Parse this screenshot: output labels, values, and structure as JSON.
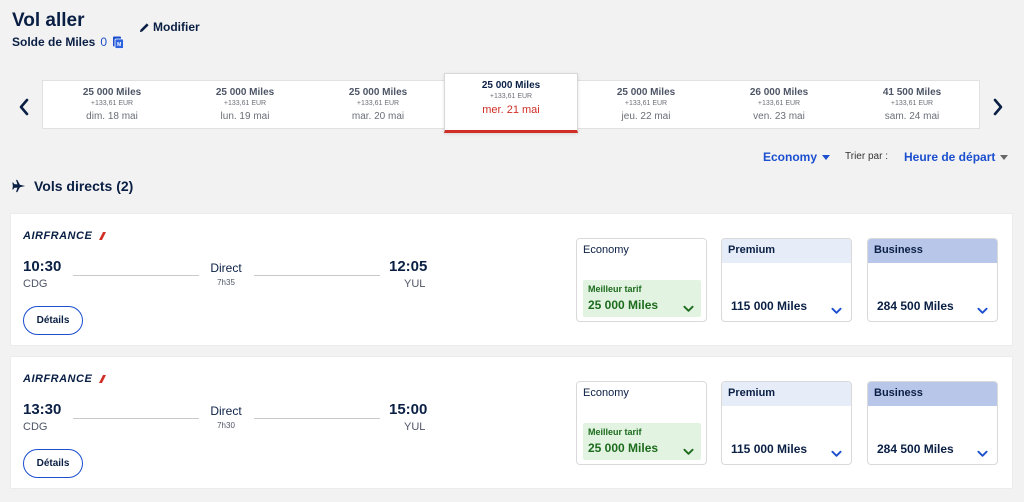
{
  "header": {
    "title": "Vol aller",
    "modify_label": "Modifier",
    "balance_label": "Solde de Miles",
    "balance_value": "0"
  },
  "dates": [
    {
      "miles": "25 000 Miles",
      "extra": "+133,61 EUR",
      "date": "dim. 18 mai",
      "selected": false
    },
    {
      "miles": "25 000 Miles",
      "extra": "+133,61 EUR",
      "date": "lun. 19 mai",
      "selected": false
    },
    {
      "miles": "25 000 Miles",
      "extra": "+133,61 EUR",
      "date": "mar. 20 mai",
      "selected": false
    },
    {
      "miles": "25 000 Miles",
      "extra": "+133,61 EUR",
      "date": "mer. 21 mai",
      "selected": true
    },
    {
      "miles": "25 000 Miles",
      "extra": "+133,61 EUR",
      "date": "jeu. 22 mai",
      "selected": false
    },
    {
      "miles": "26 000 Miles",
      "extra": "+133,61 EUR",
      "date": "ven. 23 mai",
      "selected": false
    },
    {
      "miles": "41 500 Miles",
      "extra": "+133,61 EUR",
      "date": "sam. 24 mai",
      "selected": false
    }
  ],
  "filters": {
    "cabin_value": "Economy",
    "sort_label": "Trier par :",
    "sort_value": "Heure de départ"
  },
  "section": {
    "title": "Vols directs (2)"
  },
  "flights": [
    {
      "airline": "AIRFRANCE",
      "dep_time": "10:30",
      "dep_code": "CDG",
      "arr_time": "12:05",
      "arr_code": "YUL",
      "stops": "Direct",
      "duration": "7h35",
      "details_label": "Détails",
      "fares": {
        "economy": {
          "cabin": "Economy",
          "badge": "Meilleur tarif",
          "miles": "25 000 Miles"
        },
        "premium": {
          "cabin": "Premium",
          "miles": "115 000 Miles"
        },
        "business": {
          "cabin": "Business",
          "miles": "284 500 Miles"
        }
      }
    },
    {
      "airline": "AIRFRANCE",
      "dep_time": "13:30",
      "dep_code": "CDG",
      "arr_time": "15:00",
      "arr_code": "YUL",
      "stops": "Direct",
      "duration": "7h30",
      "details_label": "Détails",
      "fares": {
        "economy": {
          "cabin": "Economy",
          "badge": "Meilleur tarif",
          "miles": "25 000 Miles"
        },
        "premium": {
          "cabin": "Premium",
          "miles": "115 000 Miles"
        },
        "business": {
          "cabin": "Business",
          "miles": "284 500 Miles"
        }
      }
    }
  ],
  "colors": {
    "accent": "#1b4fcf",
    "selected_underline": "#d02f26",
    "best_fare_bg": "#e2f3e2",
    "best_fare_text": "#1d6b1d"
  },
  "icons": {
    "modify": "pencil-icon",
    "balance": "miles-card-icon",
    "prev": "chevron-left-icon",
    "next": "chevron-right-icon",
    "section": "airplane-icon",
    "airline_mark": "airfrance-stripe-icon",
    "fare_expand": "chevron-down-icon"
  }
}
